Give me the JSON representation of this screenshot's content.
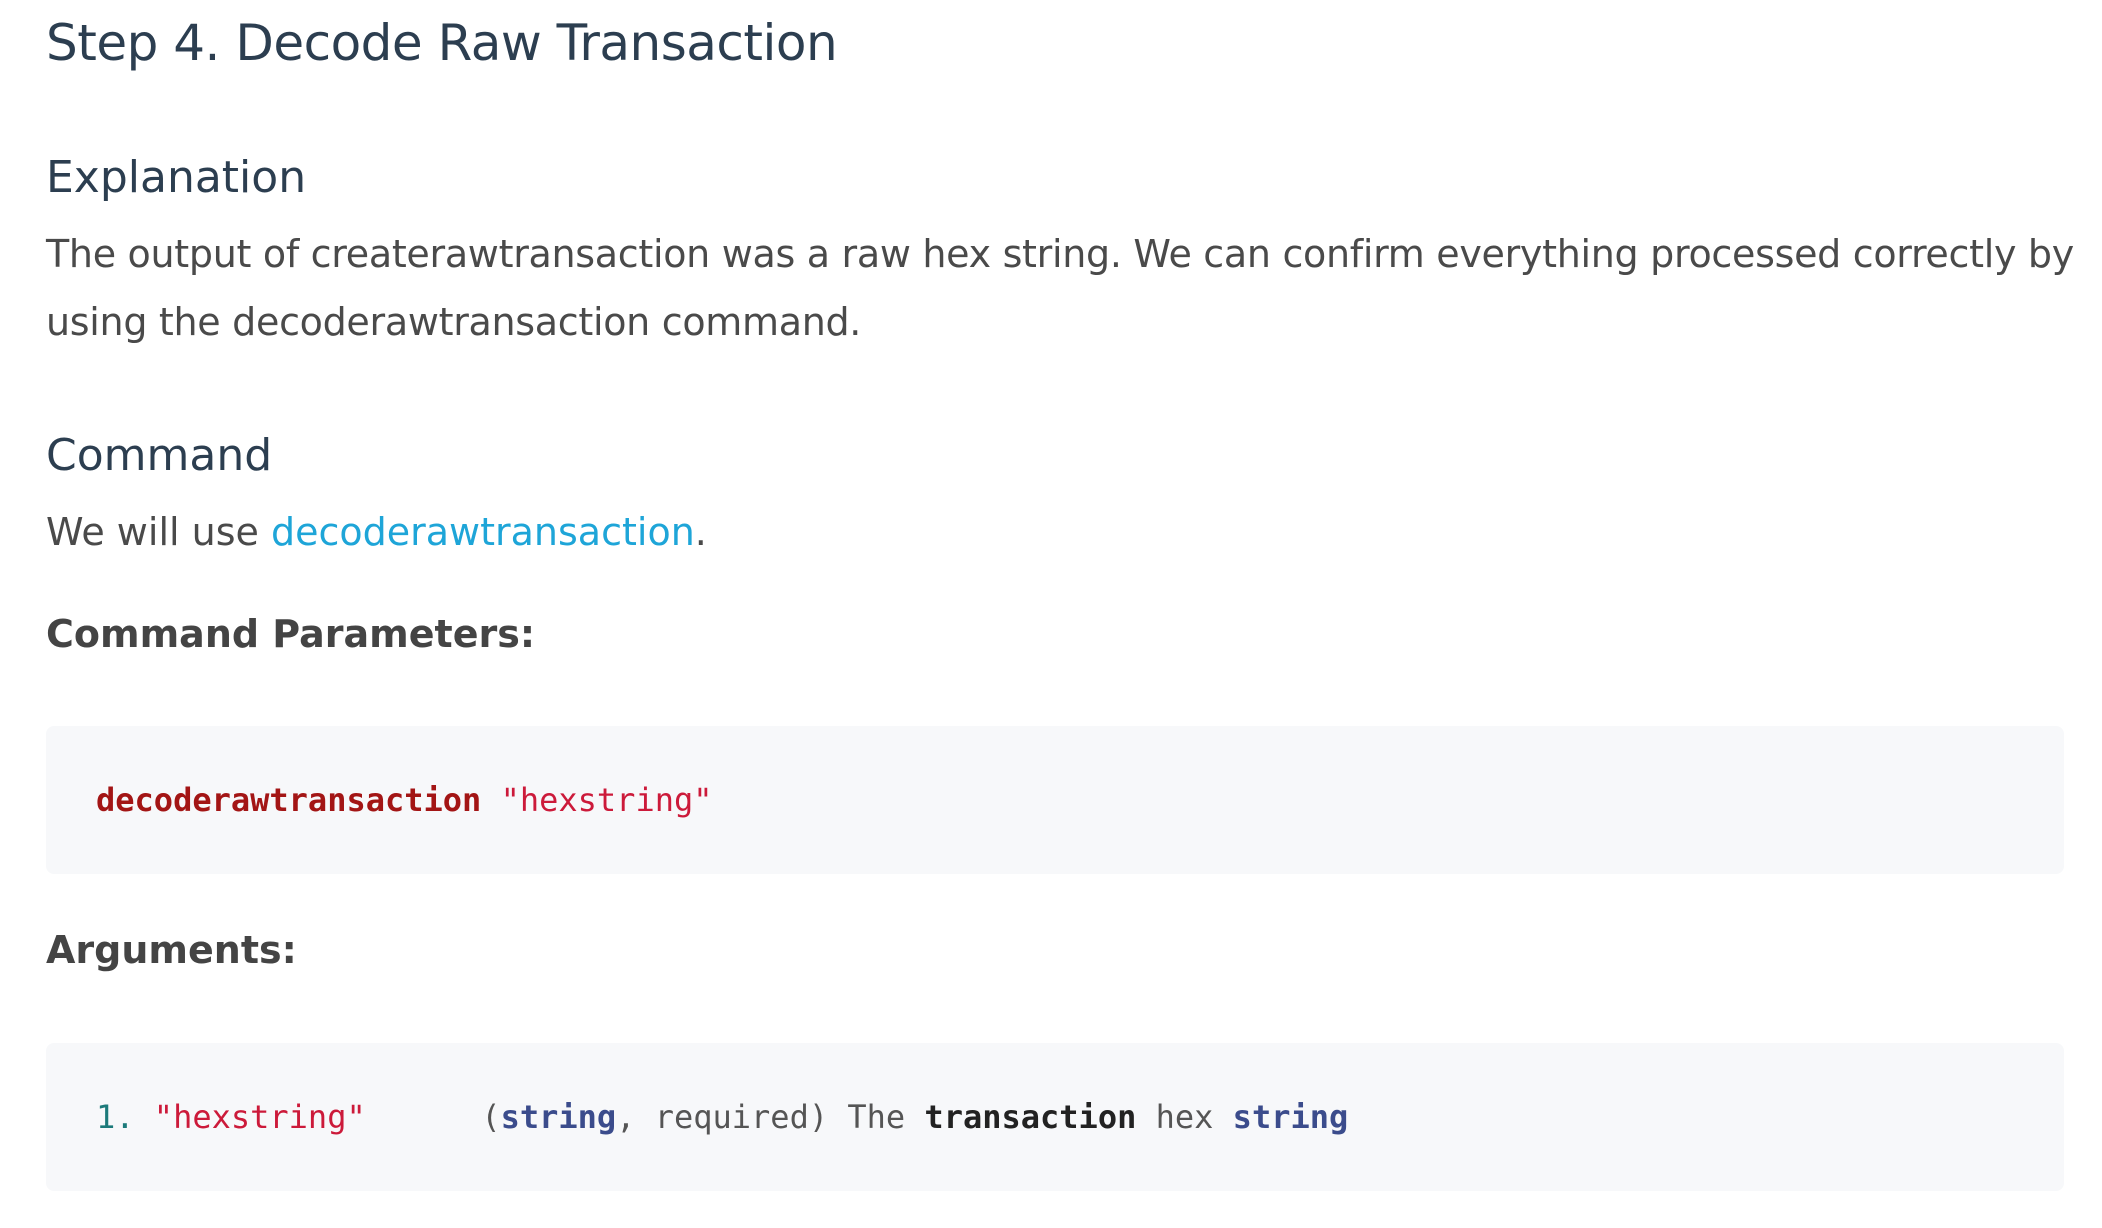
{
  "step": {
    "title": "Step 4. Decode Raw Transaction"
  },
  "explanation": {
    "heading": "Explanation",
    "text": "The output of createrawtransaction was a raw hex string. We can confirm everything processed correctly by using the decoderawtransaction command."
  },
  "command": {
    "heading": "Command",
    "intro_before": "We will use ",
    "link_text": "decoderawtransaction",
    "intro_after": "."
  },
  "parameters": {
    "heading": "Command Parameters:",
    "code_cmd": "decoderawtransaction",
    "code_arg": "\"hexstring\""
  },
  "arguments": {
    "heading": "Arguments:",
    "number": "1.",
    "name": "\"hexstring\"",
    "open_paren": "(",
    "type": "string",
    "comma_required": ", required)",
    "desc_the": "The",
    "desc_transaction": "transaction",
    "desc_hex": "hex",
    "desc_string": "string"
  },
  "colors": {
    "link": "#1ea5d8",
    "code_command": "#a31515",
    "code_string": "#cc1a3a",
    "code_number": "#1c7a7a",
    "code_type": "#3b4c8c",
    "code_background": "#f7f8fa"
  }
}
